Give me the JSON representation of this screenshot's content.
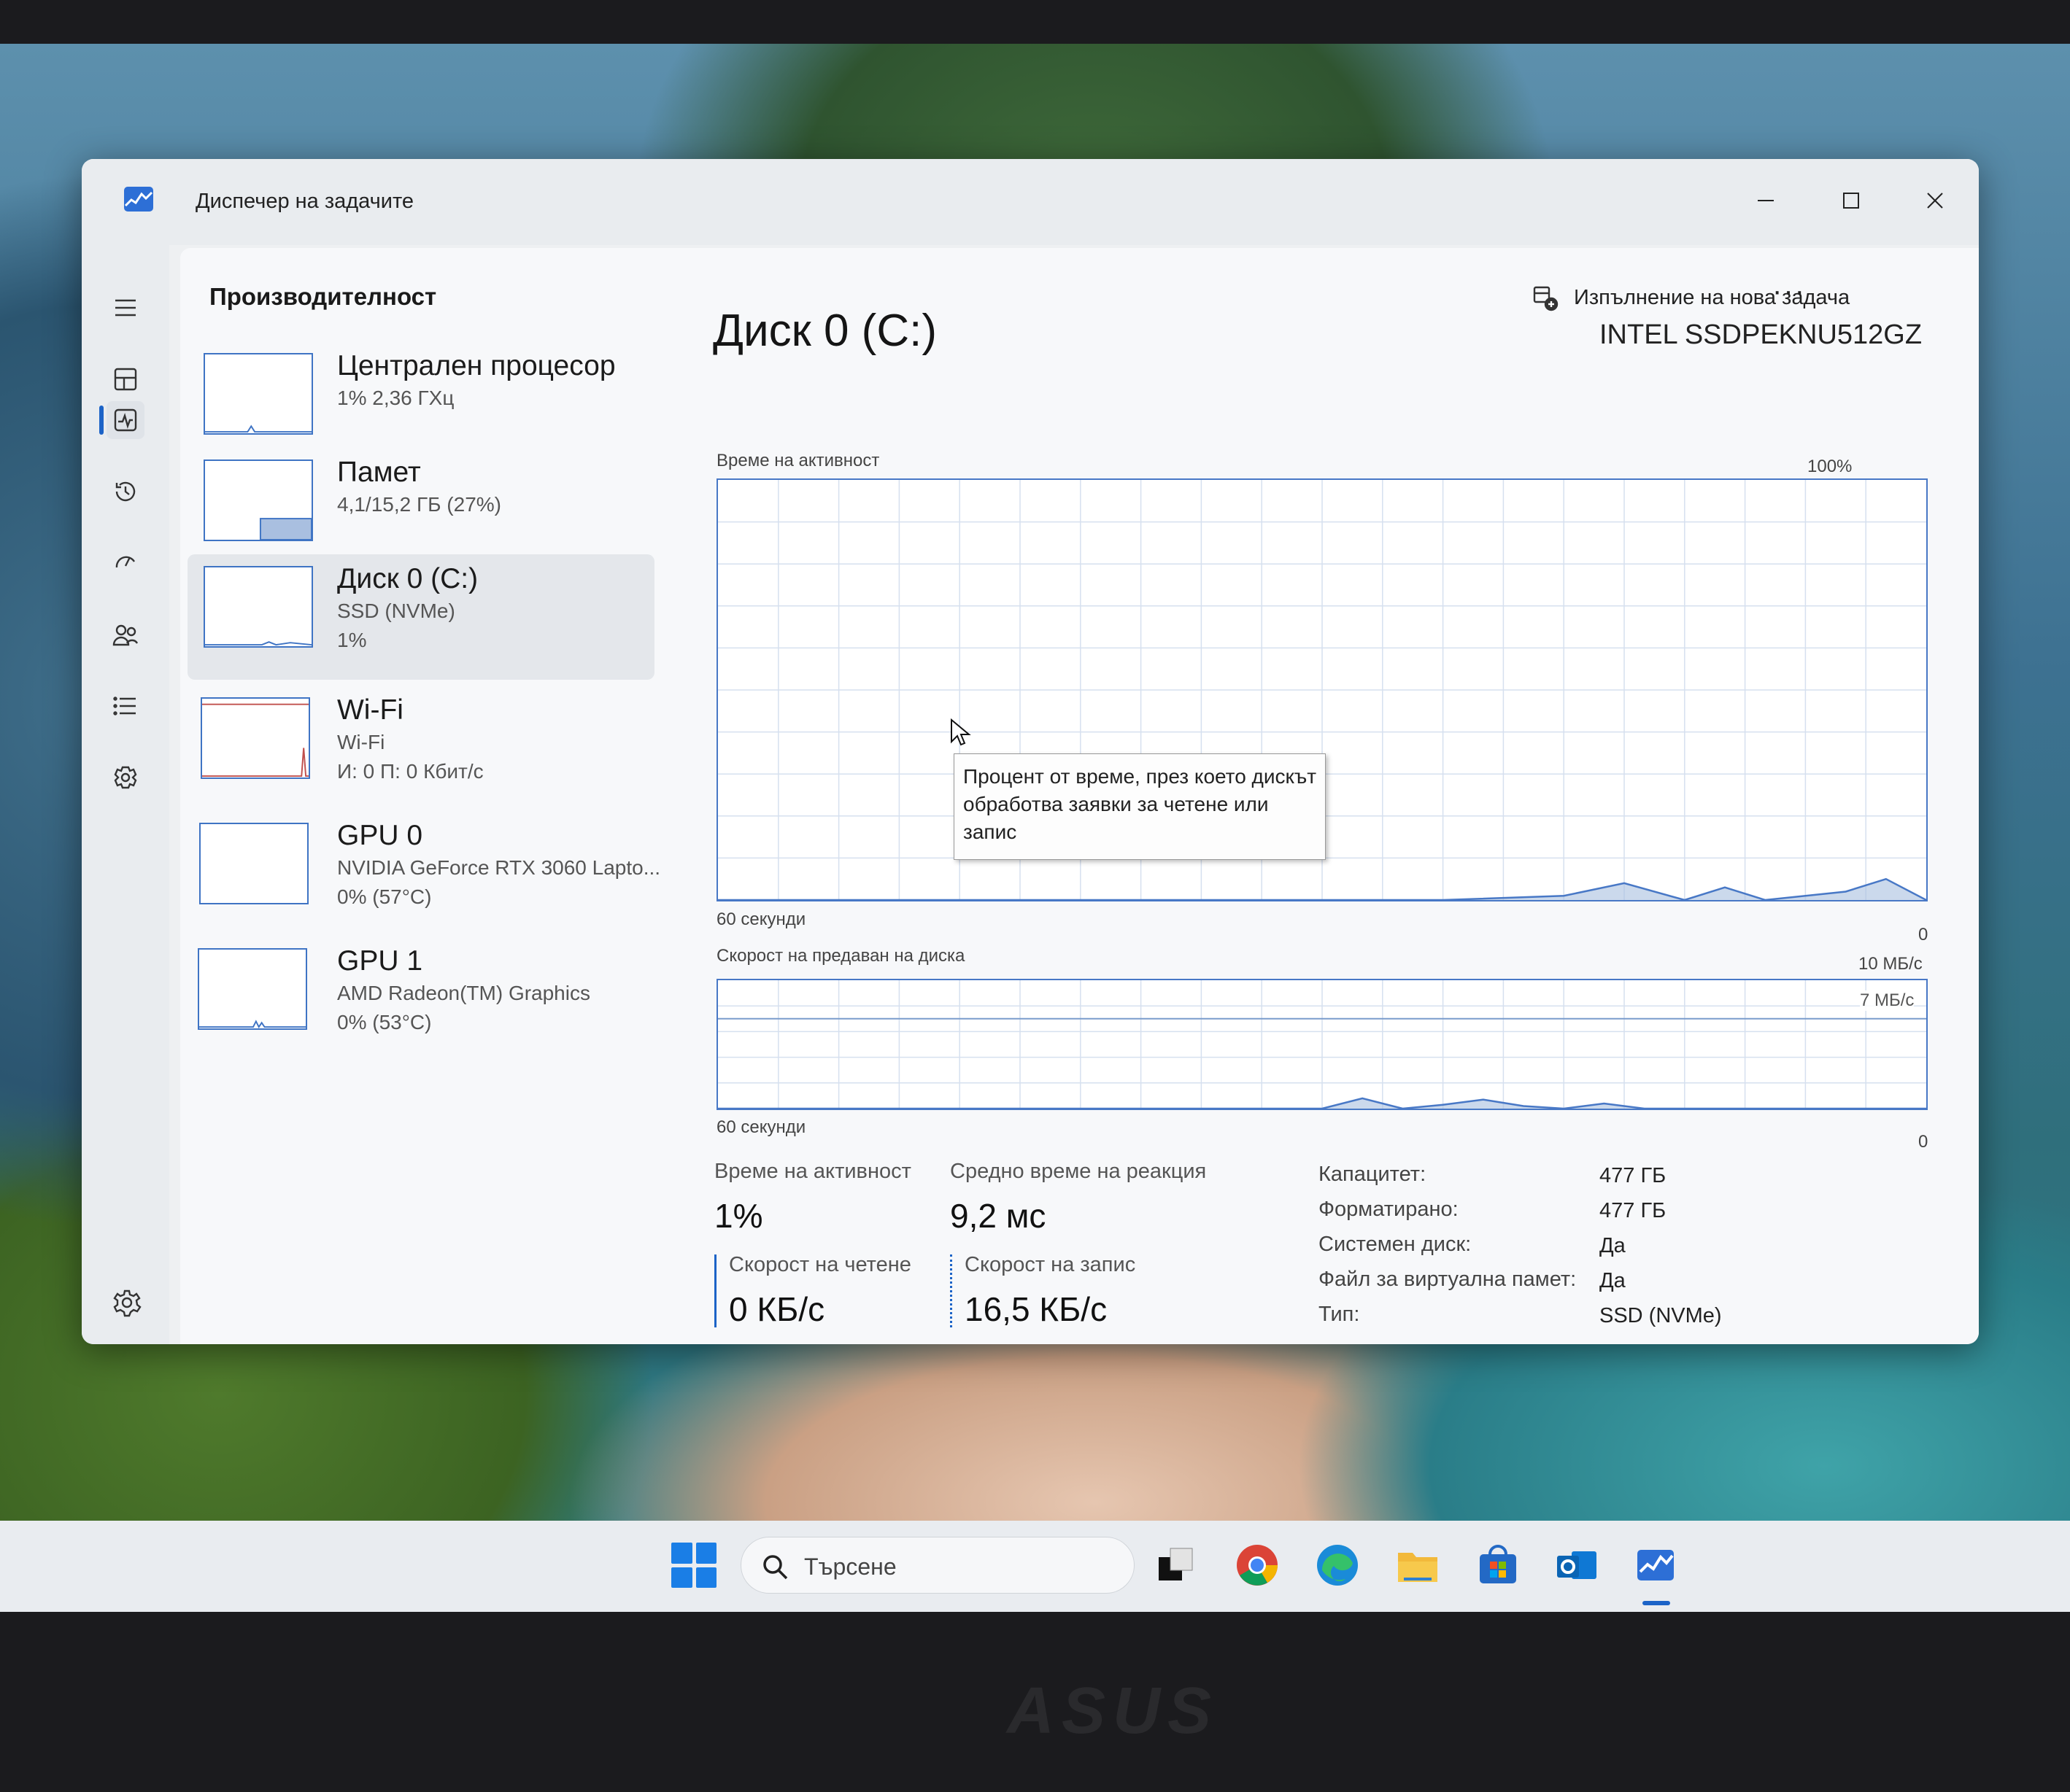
{
  "window": {
    "title": "Диспечер на задачите"
  },
  "header": {
    "section_title": "Производителност",
    "run_task_label": "Изпълнение на нова задача",
    "more_label": "···"
  },
  "devices": [
    {
      "name": "Централен процесор",
      "sub1": "1% 2,36 ГХц",
      "sub2": ""
    },
    {
      "name": "Памет",
      "sub1": "4,1/15,2 ГБ (27%)",
      "sub2": ""
    },
    {
      "name": "Диск 0 (C:)",
      "sub1": "SSD (NVMe)",
      "sub2": "1%"
    },
    {
      "name": "Wi-Fi",
      "sub1": "Wi-Fi",
      "sub2": "И: 0 П: 0 Кбит/с"
    },
    {
      "name": "GPU 0",
      "sub1": "NVIDIA GeForce RTX 3060 Lapto...",
      "sub2": "0% (57°C)"
    },
    {
      "name": "GPU 1",
      "sub1": "AMD Radeon(TM) Graphics",
      "sub2": "0% (53°C)"
    }
  ],
  "detail": {
    "title": "Диск 0 (C:)",
    "model": "INTEL SSDPEKNU512GZ",
    "chart1": {
      "label": "Време на активност",
      "max": "100%",
      "time": "60 секунди",
      "min": "0"
    },
    "chart2": {
      "label": "Скорост на предаван на диска",
      "max": "10 МБ/с",
      "line": "7 МБ/с",
      "time": "60 секунди",
      "min": "0"
    },
    "tooltip": "Процент от време, през което дискът обработва заявки за четене или запис",
    "stats": {
      "active_label": "Време на активност",
      "active_value": "1%",
      "response_label": "Средно време на реакция",
      "response_value": "9,2 мс",
      "read_label": "Скорост на четене",
      "read_value": "0 КБ/с",
      "write_label": "Скорост на запис",
      "write_value": "16,5 КБ/с"
    },
    "properties": [
      {
        "label": "Капацитет:",
        "value": "477 ГБ"
      },
      {
        "label": "Форматирано:",
        "value": "477 ГБ"
      },
      {
        "label": "Системен диск:",
        "value": "Да"
      },
      {
        "label": "Файл за виртуална памет:",
        "value": "Да"
      },
      {
        "label": "Тип:",
        "value": "SSD (NVMe)"
      }
    ]
  },
  "chart_data": [
    {
      "type": "area",
      "title": "Време на активност",
      "ylim": [
        0,
        100
      ],
      "x": [
        0,
        6,
        12,
        18,
        24,
        30,
        36,
        42,
        45,
        48,
        50,
        52,
        54,
        56,
        58,
        60
      ],
      "values": [
        0,
        0,
        0,
        0,
        0,
        0,
        0,
        1,
        4,
        0,
        3,
        0,
        1,
        2,
        5,
        0
      ],
      "xlabel": "60 секунди",
      "grid": true
    },
    {
      "type": "area",
      "title": "Скорост на предаван на диска",
      "ylim": [
        0,
        10
      ],
      "reference_line": 7,
      "x": [
        0,
        10,
        20,
        30,
        32,
        34,
        36,
        38,
        40,
        42,
        44,
        46,
        48,
        50,
        60
      ],
      "values": [
        0,
        0,
        0,
        0,
        0.8,
        0,
        0.3,
        0.7,
        0.2,
        0,
        0.4,
        0,
        0,
        0,
        0
      ],
      "xlabel": "60 секунди",
      "grid": true
    }
  ],
  "taskbar": {
    "search_placeholder": "Търсене",
    "icons": [
      "task-view-icon",
      "chrome-icon",
      "edge-icon",
      "file-explorer-icon",
      "store-icon",
      "outlook-icon",
      "task-manager-icon"
    ]
  },
  "bezel": {
    "logo": "ASUS"
  },
  "colors": {
    "accent": "#1c63c7",
    "chart_line": "#4878c6",
    "chart_fill": "#a9bfe0"
  }
}
